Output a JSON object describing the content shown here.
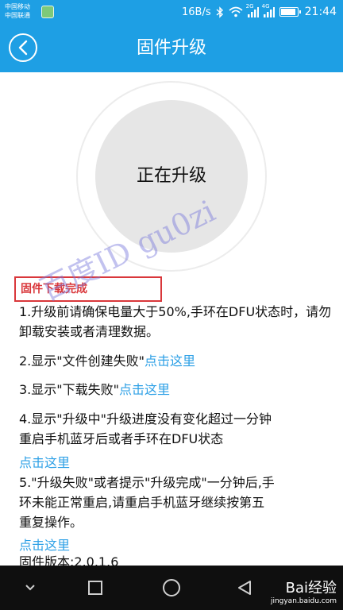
{
  "status_bar": {
    "carrier_1": "中国移动",
    "carrier_2": "中国联通",
    "net_speed": "16B/s",
    "signal_1_tag": "2G",
    "signal_2_tag": "4G",
    "time": "21:44",
    "battery_level": 0.85,
    "color": "#1e9fe4"
  },
  "header": {
    "title": "固件升级",
    "back_icon": "chevron-left-icon"
  },
  "upgrade": {
    "status": "正在升级"
  },
  "content": {
    "download_status": "固件下载完成",
    "tip1": "1.升级前请确保电量大于50%,手环在DFU状态时，请勿卸载安装或者清理数据。",
    "tip2_text": "2.显示\"文件创建失败\"",
    "tip2_link": "点击这里",
    "tip3_text": "3.显示\"下载失败\"",
    "tip3_link": "点击这里",
    "tip4_line1": "4.显示\"升级中\"升级进度没有变化超过一分钟",
    "tip4_line2": "重启手机蓝牙后或者手环在DFU状态",
    "tip4_link": "点击这里",
    "tip5_line1": "5.\"升级失败\"或者提示\"升级完成\"一分钟后,手",
    "tip5_line2": "环未能正常重启,请重启手机蓝牙继续按第五",
    "tip5_line3": "重复操作。",
    "tip5_link": "点击这里",
    "version": "固件版本:2.0.1.6",
    "link_color": "#2da0e6",
    "alert_color": "#d9373b"
  },
  "watermark": "百度ID gu0zi",
  "nav_bar": {
    "back_icon": "triangle-back-icon",
    "home_icon": "circle-home-icon",
    "recents_icon": "square-recents-icon",
    "baidu_label": "Bai经验",
    "baidu_url": "jingyan.baidu.com"
  }
}
